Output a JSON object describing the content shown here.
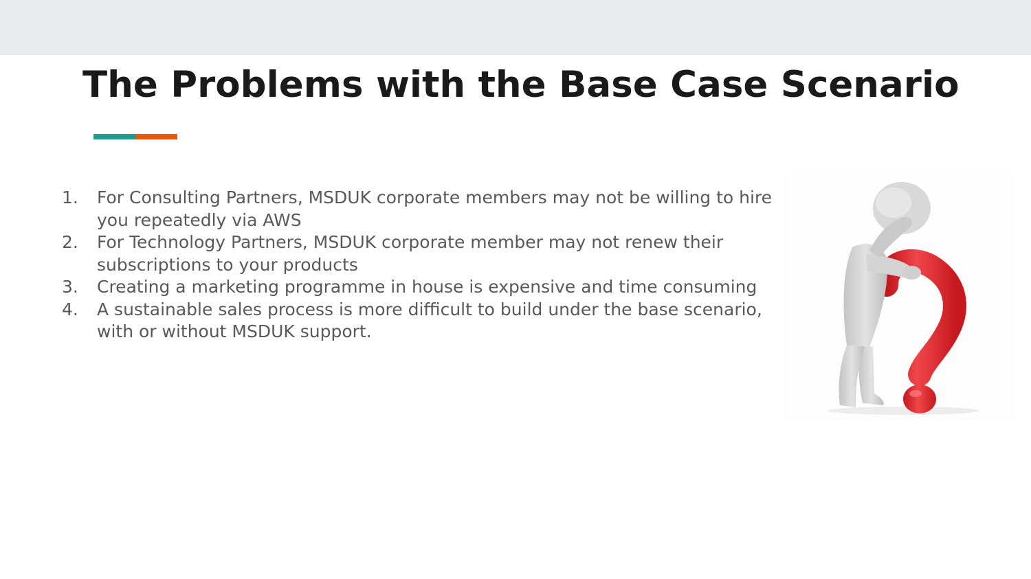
{
  "slide": {
    "title": "The Problems with the Base Case Scenario",
    "accent_colors": {
      "teal": "#1f9a8c",
      "orange": "#e8590c"
    },
    "points": [
      {
        "number": "1.",
        "text": "For Consulting Partners, MSDUK corporate members may not be willing to hire you repeatedly via AWS"
      },
      {
        "number": "2.",
        "text": "For Technology Partners, MSDUK corporate member may not renew their subscriptions to your products"
      },
      {
        "number": "3.",
        "text": "Creating a marketing programme in house is expensive and time consuming"
      },
      {
        "number": "4.",
        "text": "A sustainable sales process is more difficult to build under the base scenario, with or without MSDUK support."
      }
    ],
    "illustration": {
      "icon": "thinking-figure-question-mark-icon",
      "figure_color": "#d9d9d9",
      "question_mark_color": "#e8262a"
    }
  }
}
